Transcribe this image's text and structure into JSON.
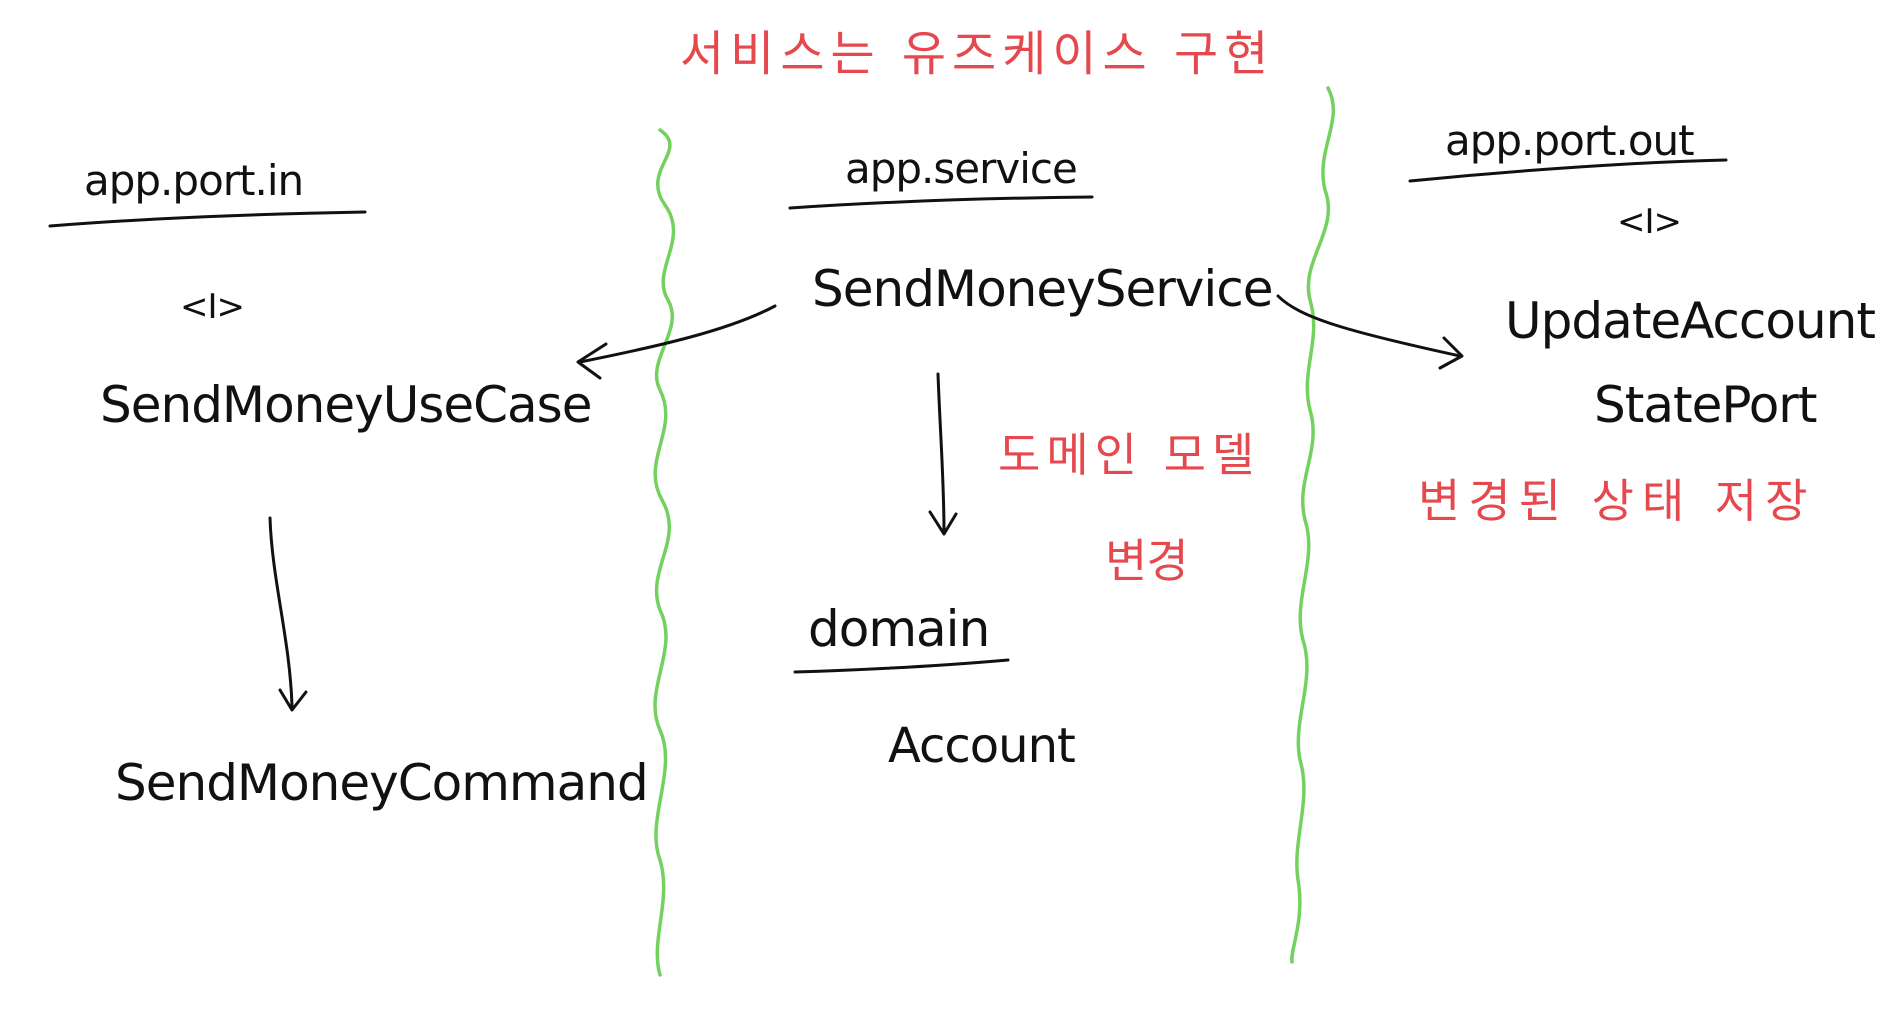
{
  "title": "서비스는 유즈케이스 구현",
  "colors": {
    "ink": "#111111",
    "annotation": "#e5484d",
    "divider": "#74d15f",
    "background": "#ffffff"
  },
  "columns": {
    "port_in": {
      "package": "app.port.in",
      "interface_marker": "<I>",
      "usecase": "SendMoneyUseCase",
      "command": "SendMoneyCommand"
    },
    "service": {
      "package": "app.service",
      "service": "SendMoneyService",
      "note_line1": "도메인 모델",
      "note_line2": "변경",
      "domain_package": "domain",
      "domain_class": "Account"
    },
    "port_out": {
      "package": "app.port.out",
      "interface_marker": "<I>",
      "port_line1": "UpdateAccount",
      "port_line2": "StatePort",
      "note": "변경된 상태 저장"
    }
  }
}
